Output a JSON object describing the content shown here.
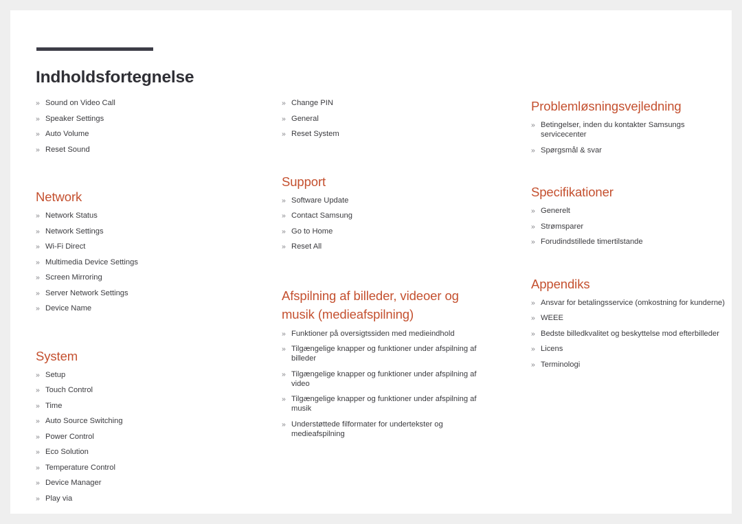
{
  "document": {
    "title": "Indholdsfortegnelse",
    "bullet_glyph": "»",
    "accent_color": "#c4502f",
    "title_color": "#2f2f35",
    "rule_color": "#3d3d47",
    "body_color": "#3b3b3f",
    "page_background": "#ffffff",
    "canvas_background": "#efefef"
  },
  "columns": [
    {
      "name": "column-left",
      "sections": [
        {
          "heading": "",
          "items": [
            "Sound on Video Call",
            "Speaker Settings",
            "Auto Volume",
            "Reset Sound"
          ]
        },
        {
          "heading": "Network",
          "items": [
            "Network Status",
            "Network Settings",
            "Wi-Fi Direct",
            "Multimedia Device Settings",
            "Screen Mirroring",
            "Server Network Settings",
            "Device Name"
          ]
        },
        {
          "heading": "System",
          "items": [
            "Setup",
            "Touch Control",
            "Time",
            "Auto Source Switching",
            "Power Control",
            "Eco Solution",
            "Temperature Control",
            "Device Manager",
            "Play via"
          ]
        }
      ]
    },
    {
      "name": "column-middle",
      "sections": [
        {
          "heading": "",
          "items": [
            "Change PIN",
            "General",
            "Reset System"
          ]
        },
        {
          "heading": "Support",
          "items": [
            "Software Update",
            "Contact Samsung",
            "Go to Home",
            "Reset All"
          ]
        },
        {
          "heading": "Afspilning af billeder, videoer og musik (medieafspilning)",
          "items": [
            "Funktioner på oversigtssiden med medieindhold",
            "Tilgængelige knapper og funktioner under afspilning af billeder",
            "Tilgængelige knapper og funktioner under afspilning af video",
            "Tilgængelige knapper og funktioner under afspilning af musik",
            "Understøttede filformater for undertekster og medieafspilning"
          ]
        }
      ]
    },
    {
      "name": "column-right",
      "sections": [
        {
          "heading": "Problemløsningsvejledning",
          "items": [
            "Betingelser, inden du kontakter Samsungs servicecenter",
            "Spørgsmål & svar"
          ]
        },
        {
          "heading": "Specifikationer",
          "items": [
            "Generelt",
            "Strømsparer",
            "Forudindstillede timertilstande"
          ]
        },
        {
          "heading": "Appendiks",
          "items": [
            "Ansvar for betalingsservice (omkostning for kunderne)",
            "WEEE",
            "Bedste billedkvalitet og beskyttelse mod efterbilleder",
            "Licens",
            "Terminologi"
          ]
        }
      ]
    }
  ]
}
